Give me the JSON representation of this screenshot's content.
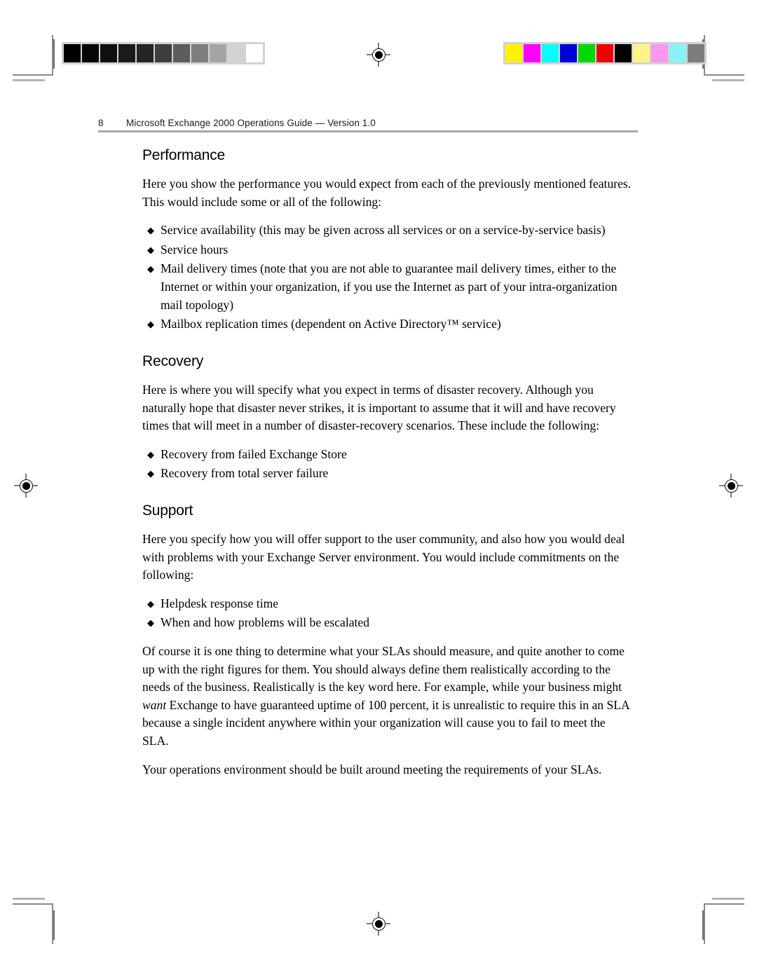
{
  "document": {
    "running_head": {
      "page_number": "8",
      "title": "Microsoft Exchange 2000 Operations Guide — Version 1.0"
    },
    "sections": [
      {
        "heading": "Performance",
        "intro": "Here you show the performance you would expect from each of the previously mentioned features. This would include some or all of the following:",
        "bullets": [
          "Service availability (this may be given across all services or on a service-by-service basis)",
          "Service hours",
          "Mail delivery times (note that you are not able to guarantee mail delivery times, either to the Internet or within your organization, if you use the Internet as part of your intra-organization mail topology)",
          "Mailbox replication times (dependent on Active Directory™ service)"
        ]
      },
      {
        "heading": "Recovery",
        "intro": "Here is where you will specify what you expect in terms of disaster recovery. Although you naturally hope that disaster never strikes, it is important to assume that it will and have recovery times that will meet in a number of disaster-recovery scenarios. These include the following:",
        "bullets": [
          "Recovery from failed Exchange Store",
          "Recovery from total server failure"
        ]
      },
      {
        "heading": "Support",
        "intro": "Here you specify how you will offer support to the user community, and also how you would deal with problems with your Exchange Server environment. You would include commitments on the following:",
        "bullets": [
          "Helpdesk response time",
          "When and how problems will be escalated"
        ]
      }
    ],
    "closing_paragraphs": {
      "paragraph_1_part_1": "Of course it is one thing to determine what your SLAs should measure, and quite another to come up with the right figures for them. You should always define them realistically according to the needs of the business. Realistically is the key word here. For example, while your business might ",
      "paragraph_1_emphasis": "want",
      "paragraph_1_part_2": " Exchange to have guaranteed uptime of 100 percent, it is unrealistic to require this in an SLA because a single incident anywhere within your organization will cause you to fail to meet the SLA.",
      "paragraph_2": "Your operations environment should be built around meeting the requirements of your SLAs."
    },
    "bullet_glyph": "◆",
    "prepress": {
      "grayscale_strip": {
        "label": "grayscale-calibration-strip",
        "patches": [
          "#010101",
          "#070707",
          "#0f0f0f",
          "#1a1a1a",
          "#242424",
          "#3d3d3d",
          "#5c5c5c",
          "#7e7e7e",
          "#a5a5a5",
          "#d2d2d2",
          "#ffffff"
        ]
      },
      "color_strip": {
        "label": "color-calibration-strip",
        "patches": [
          "#fff200",
          "#ff00ff",
          "#00ffff",
          "#0000d8",
          "#00d800",
          "#ee0000",
          "#000000",
          "#fdf38a",
          "#ff97f0",
          "#86f3f6",
          "#7d7d7d"
        ]
      }
    }
  }
}
